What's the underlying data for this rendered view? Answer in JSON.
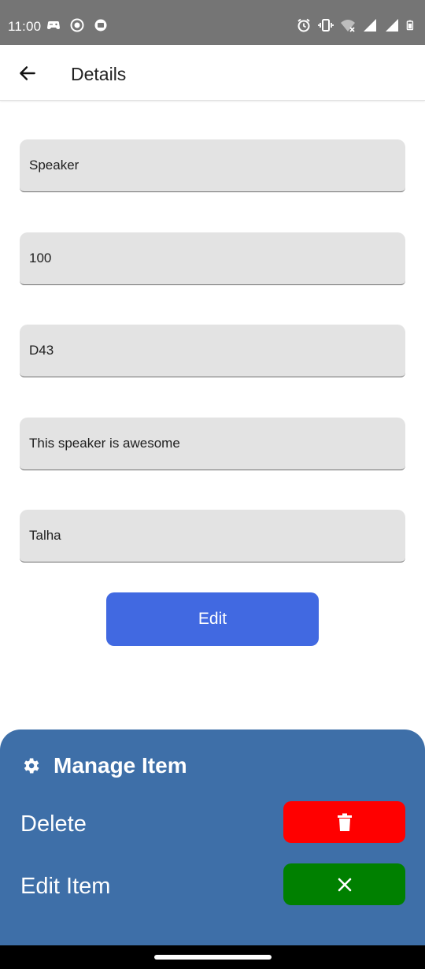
{
  "status_bar": {
    "time": "11:00",
    "left_icons": [
      "game-controller-icon",
      "record-icon",
      "screencast-icon"
    ],
    "right_icons": [
      "alarm-icon",
      "vibrate-icon",
      "wifi-off-icon",
      "signal-icon",
      "signal-icon",
      "battery-icon"
    ]
  },
  "app_bar": {
    "back_icon": "arrow-left-icon",
    "title": "Details"
  },
  "form": {
    "fields": [
      {
        "value": "Speaker"
      },
      {
        "value": "100"
      },
      {
        "value": "D43"
      },
      {
        "value": "This speaker is awesome"
      },
      {
        "value": "Talha"
      }
    ],
    "edit_label": "Edit",
    "button_color": "#4169E1"
  },
  "sheet": {
    "icon": "gear-icon",
    "title": "Manage Item",
    "background": "#3E6FA8",
    "delete_label": "Delete",
    "delete_icon": "trash-icon",
    "delete_color": "#FF0000",
    "edit_item_label": "Edit Item",
    "edit_item_icon": "close-icon",
    "edit_item_color": "#008000"
  }
}
